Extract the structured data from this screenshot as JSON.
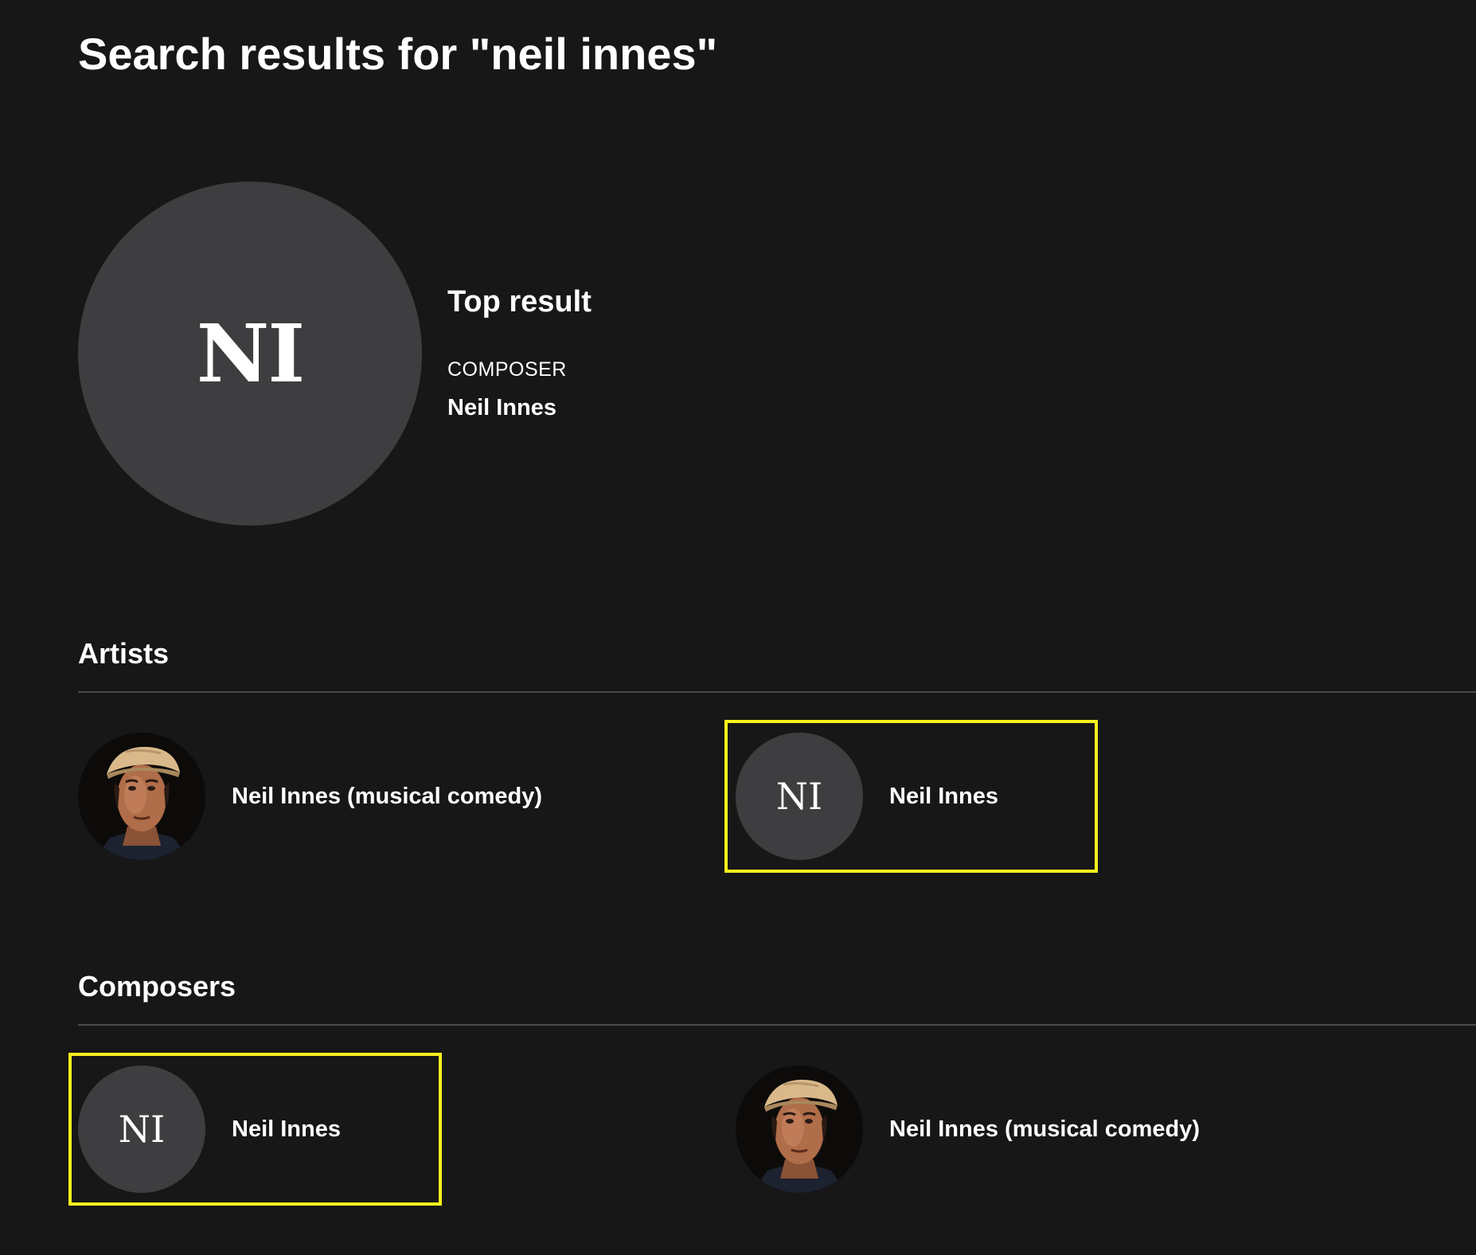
{
  "page": {
    "title": "Search results for \"neil innes\""
  },
  "top_result": {
    "heading": "Top result",
    "type": "COMPOSER",
    "name": "Neil Innes",
    "initials": "NI"
  },
  "artists": {
    "title": "Artists",
    "items": [
      {
        "name": "Neil Innes (musical comedy)",
        "avatar": "photo"
      },
      {
        "name": "Neil Innes",
        "initials": "NI",
        "highlighted": true
      }
    ]
  },
  "composers": {
    "title": "Composers",
    "items": [
      {
        "name": "Neil Innes",
        "initials": "NI",
        "highlighted": true
      },
      {
        "name": "Neil Innes (musical comedy)",
        "avatar": "photo"
      }
    ]
  },
  "colors": {
    "background": "#171717",
    "avatar_placeholder": "#3e3e40",
    "highlight": "#f7f21c",
    "divider": "#4a4a4a"
  }
}
